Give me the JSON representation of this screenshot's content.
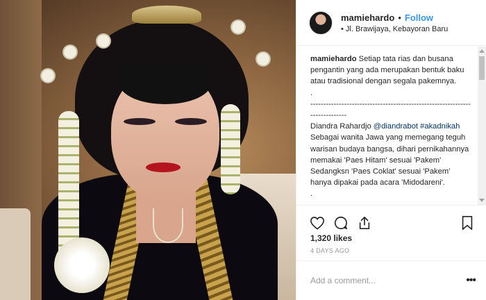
{
  "post": {
    "username": "mamiehardo",
    "follow_label": "Follow",
    "location": "Jl. Brawijaya, Kebayoran Baru"
  },
  "caption": {
    "username": "mamiehardo",
    "line1": "Setiap tata rias dan busana pengantin yang ada merupakan bentuk baku atau tradisional dengan segala pakemnya.",
    "dot1": ".",
    "dashes": "----------------------------------------------------------------------------",
    "author": "Diandra Rahardjo",
    "mention": "@diandrabot",
    "hashtag": "#akadnikah",
    "para1": "Sebagai wanita Jawa yang memegang teguh warisan budaya bangsa, dihari pernikahannya memakai 'Paes Hitam' sesuai 'Pakem'",
    "para2": "Sedangksn 'Paes Coklat' sesuai 'Pakem' hanya dipakai pada acara 'Midodareni'.",
    "dot2": "."
  },
  "likes": "1,320 likes",
  "date": "4 DAYS AGO",
  "comment": {
    "placeholder": "Add a comment..."
  },
  "icons": {
    "like": "heart-icon",
    "comment": "comment-icon",
    "share": "share-icon",
    "save": "bookmark-icon",
    "more": "more-icon"
  },
  "colors": {
    "follow": "#3897f0",
    "mention": "#003569"
  }
}
